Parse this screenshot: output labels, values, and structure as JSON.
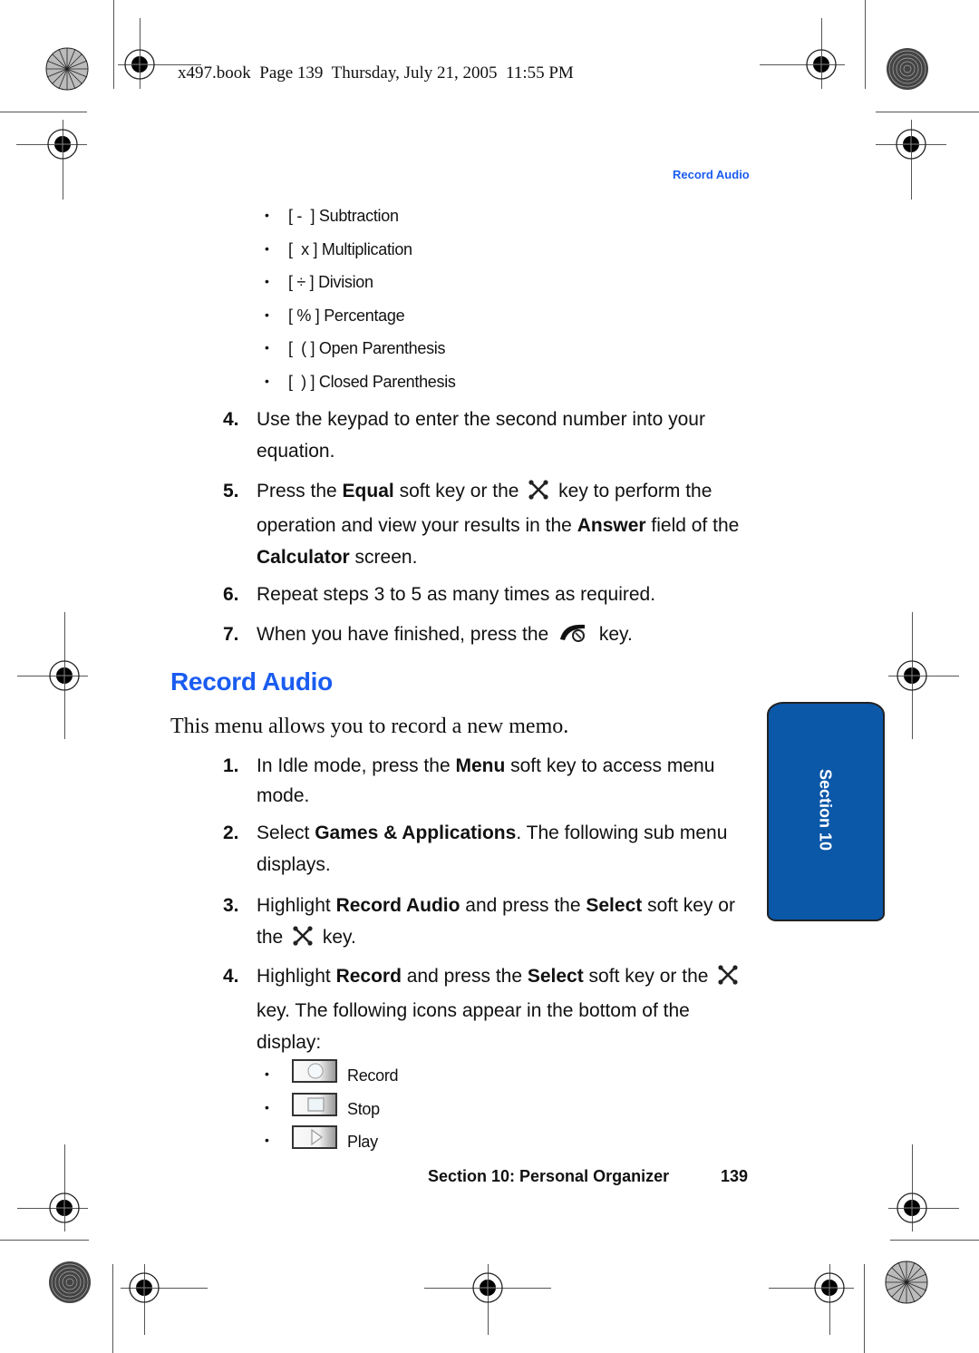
{
  "print_header": {
    "slug": "x497.book  Page 139  Thursday, July 21, 2005  11:55 PM"
  },
  "running_head": "Record Audio",
  "operator_bullets": [
    {
      "symbol": "[ -  ]",
      "label": "Subtraction"
    },
    {
      "symbol": "[  x ]",
      "label": "Multiplication"
    },
    {
      "symbol": "[ ÷ ]",
      "label": "Division"
    },
    {
      "symbol": "[ % ]",
      "label": "Percentage"
    },
    {
      "symbol": "[  ( ]",
      "label": "Open Parenthesis"
    },
    {
      "symbol": "[  ) ]",
      "label": "Closed Parenthesis"
    }
  ],
  "calculator_steps": [
    {
      "num": "4.",
      "parts": [
        "Use the keypad to enter the second number into your equation."
      ]
    },
    {
      "num": "5.",
      "parts": [
        "Press the ",
        {
          "b": "Equal"
        },
        " soft key or the ",
        {
          "icon": "ok-key-icon"
        },
        " key to perform the operation and view your results in the ",
        {
          "b": "Answer"
        },
        " field of the ",
        {
          "b": "Calculator"
        },
        " screen."
      ]
    },
    {
      "num": "6.",
      "parts": [
        "Repeat steps 3 to 5 as many times as required."
      ]
    },
    {
      "num": "7.",
      "parts": [
        "When you have finished, press the ",
        {
          "icon": "end-key-icon"
        },
        " key."
      ]
    }
  ],
  "section": {
    "title": "Record Audio",
    "intro": "This menu allows you to record a new memo."
  },
  "record_steps": [
    {
      "num": "1.",
      "parts": [
        "In Idle mode, press the ",
        {
          "b": "Menu"
        },
        " soft key to access menu mode."
      ]
    },
    {
      "num": "2.",
      "parts": [
        "Select ",
        {
          "b": "Games & Applications"
        },
        ". The following sub menu displays."
      ]
    },
    {
      "num": "3.",
      "parts": [
        "Highlight ",
        {
          "b": "Record Audio"
        },
        " and press the ",
        {
          "b": "Select"
        },
        " soft key or the ",
        {
          "icon": "ok-key-icon"
        },
        " key."
      ]
    },
    {
      "num": "4.",
      "parts": [
        "Highlight ",
        {
          "b": "Record"
        },
        " and press the ",
        {
          "b": "Select"
        },
        " soft key or the ",
        {
          "icon": "ok-key-icon"
        },
        " key.  The following icons appear in the bottom of the display:"
      ]
    }
  ],
  "display_icons": [
    {
      "icon": "record-icon",
      "label": "Record"
    },
    {
      "icon": "stop-icon",
      "label": "Stop"
    },
    {
      "icon": "play-icon",
      "label": "Play"
    }
  ],
  "section_tab": {
    "label": "Section 10",
    "color": "#0b57a8"
  },
  "footer": {
    "section": "Section 10: Personal Organizer",
    "page": "139"
  },
  "colors": {
    "accent": "#1a5cf0",
    "tab_blue": "#0b57a8"
  }
}
